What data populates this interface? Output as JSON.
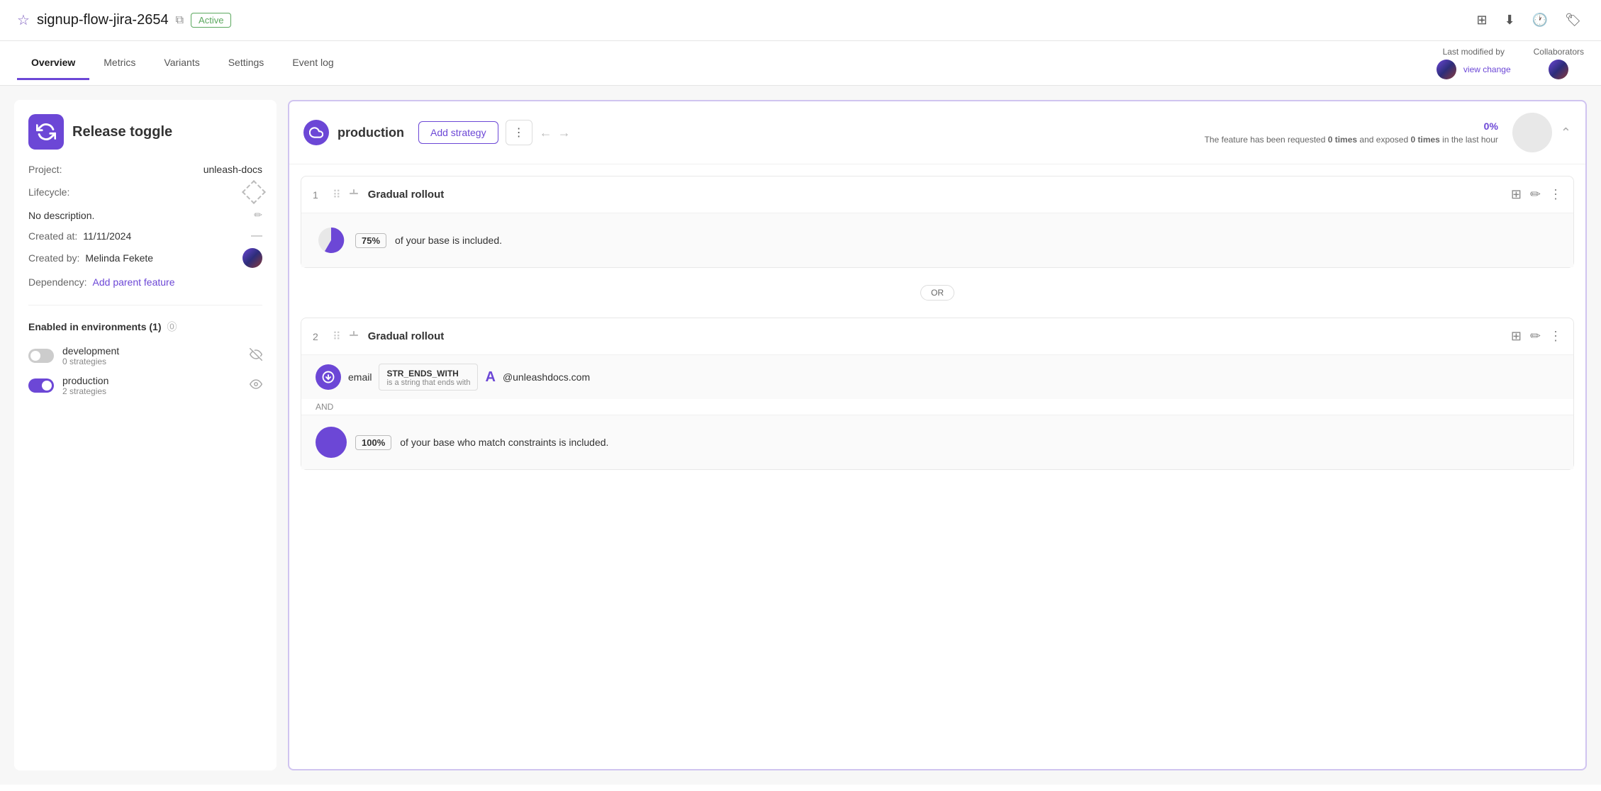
{
  "header": {
    "feature_name": "signup-flow-jira-2654",
    "status_badge": "Active",
    "icons": [
      "add-icon",
      "download-icon",
      "history-icon",
      "tag-icon"
    ]
  },
  "nav": {
    "tabs": [
      {
        "label": "Overview",
        "active": true
      },
      {
        "label": "Metrics",
        "active": false
      },
      {
        "label": "Variants",
        "active": false
      },
      {
        "label": "Settings",
        "active": false
      },
      {
        "label": "Event log",
        "active": false
      }
    ],
    "last_modified_label": "Last modified by",
    "view_change_link": "view change",
    "collaborators_label": "Collaborators"
  },
  "left_panel": {
    "feature_icon": "↻",
    "feature_title": "Release toggle",
    "project_label": "Project:",
    "project_value": "unleash-docs",
    "lifecycle_label": "Lifecycle:",
    "description_text": "No description.",
    "created_at_label": "Created at:",
    "created_at_value": "11/11/2024",
    "created_by_label": "Created by:",
    "created_by_name": "Melinda Fekete",
    "dependency_label": "Dependency:",
    "add_parent_label": "Add parent feature"
  },
  "environments_section": {
    "title": "Enabled in environments (1)",
    "items": [
      {
        "name": "development",
        "strategies": "0 strategies",
        "enabled": false
      },
      {
        "name": "production",
        "strategies": "2 strategies",
        "enabled": true
      }
    ]
  },
  "production_env": {
    "name": "production",
    "add_strategy_label": "Add strategy",
    "percent": "0%",
    "stat_text_prefix": "The feature has been requested ",
    "stat_requested": "0 times",
    "stat_mid": "and exposed ",
    "stat_exposed": "0 times",
    "stat_suffix": " in the last hour",
    "strategies": [
      {
        "number": "1",
        "name": "Gradual rollout",
        "body_type": "pie",
        "percentage": "75%",
        "body_text": "of your base is included."
      },
      {
        "number": "2",
        "name": "Gradual rollout",
        "body_type": "constraint",
        "constraint_field": "email",
        "constraint_op_label": "STR_ENDS_WITH",
        "constraint_op_sub": "is a string that ends with",
        "constraint_letter": "A",
        "constraint_domain": "@unleashdocs.com",
        "and_label": "AND",
        "percentage": "100%",
        "body_text2": "of your base who match constraints is included."
      }
    ],
    "or_divider": "OR"
  }
}
